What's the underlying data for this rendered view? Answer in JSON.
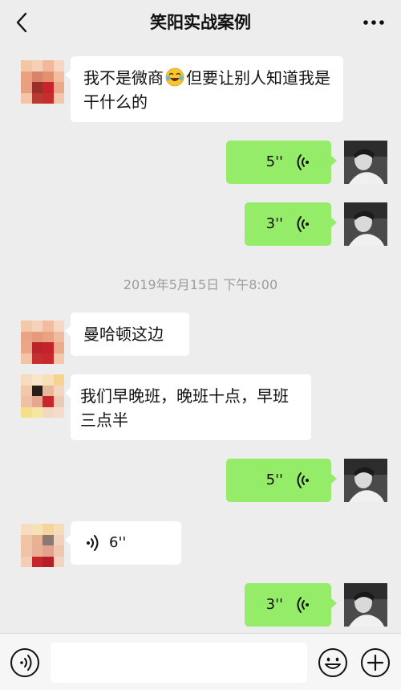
{
  "header": {
    "title": "笑阳实战案例",
    "back_icon": "chevron-left-icon",
    "more_icon": "more-dots-icon"
  },
  "messages": [
    {
      "dir": "in",
      "type": "text",
      "text_before": "我不是微商",
      "emoji": "laughing-crying-emoji",
      "text_after": "但要让别人知道我是干什么的"
    },
    {
      "dir": "out",
      "type": "voice",
      "duration": "5''"
    },
    {
      "dir": "out",
      "type": "voice",
      "duration": "3''"
    },
    {
      "dir": "in",
      "type": "text",
      "text": "曼哈顿这边"
    },
    {
      "dir": "in",
      "type": "text",
      "text": "我们早晚班，晚班十点，早班三点半"
    },
    {
      "dir": "out",
      "type": "voice",
      "duration": "5''"
    },
    {
      "dir": "in",
      "type": "voice",
      "duration": "6''"
    },
    {
      "dir": "out",
      "type": "voice",
      "duration": "3''"
    }
  ],
  "timestamp": "2019年5月15日 下午8:00",
  "input_bar": {
    "voice_icon": "voice-toggle-icon",
    "text_value": "",
    "emoji_icon": "emoji-icon",
    "plus_icon": "plus-icon"
  },
  "colors": {
    "background": "#ededed",
    "bubble_out": "#95ec69",
    "bubble_in": "#ffffff",
    "timestamp": "#9c9c9c"
  }
}
